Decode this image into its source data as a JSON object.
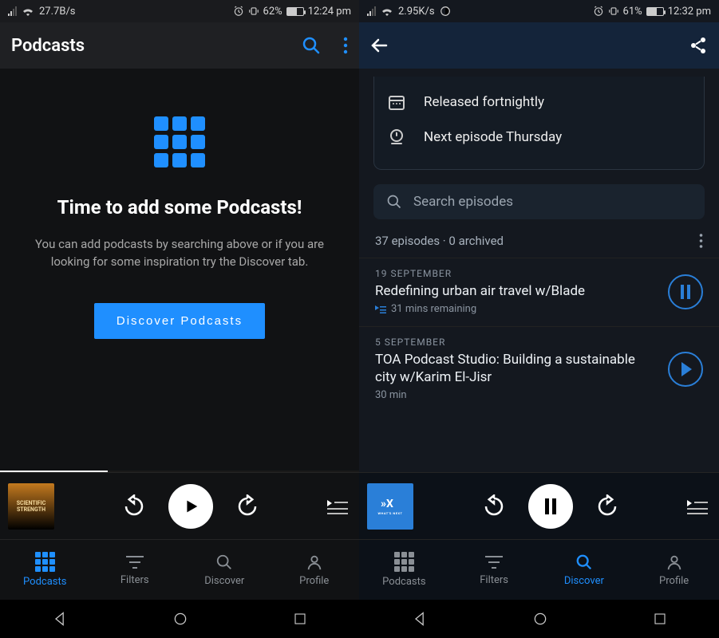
{
  "left": {
    "status": {
      "speed": "27.7B/s",
      "battery": "62%",
      "time": "12:24 pm"
    },
    "title": "Podcasts",
    "empty": {
      "heading": "Time to add some Podcasts!",
      "body": "You can add podcasts by searching above or if you are looking for some inspiration try the Discover tab.",
      "button": "Discover Podcasts"
    },
    "artwork": "SCIENTIFIC STRENGTH",
    "nav": {
      "podcasts": "Podcasts",
      "filters": "Filters",
      "discover": "Discover",
      "profile": "Profile"
    }
  },
  "right": {
    "status": {
      "speed": "2.95K/s",
      "battery": "61%",
      "time": "12:32 pm"
    },
    "info": {
      "release": "Released fortnightly",
      "next": "Next episode Thursday"
    },
    "search_placeholder": "Search episodes",
    "meta": "37 episodes · 0 archived",
    "episodes": [
      {
        "date": "19 SEPTEMBER",
        "title": "Redefining urban air travel w/Blade",
        "sub": "31 mins remaining",
        "state": "pause"
      },
      {
        "date": "5 SEPTEMBER",
        "title": "TOA Podcast Studio: Building a sustainable city w/Karim El-Jisr",
        "sub": "30 min",
        "state": "play"
      }
    ],
    "artwork": "WHAT'S NEXT",
    "nav": {
      "podcasts": "Podcasts",
      "filters": "Filters",
      "discover": "Discover",
      "profile": "Profile"
    }
  }
}
